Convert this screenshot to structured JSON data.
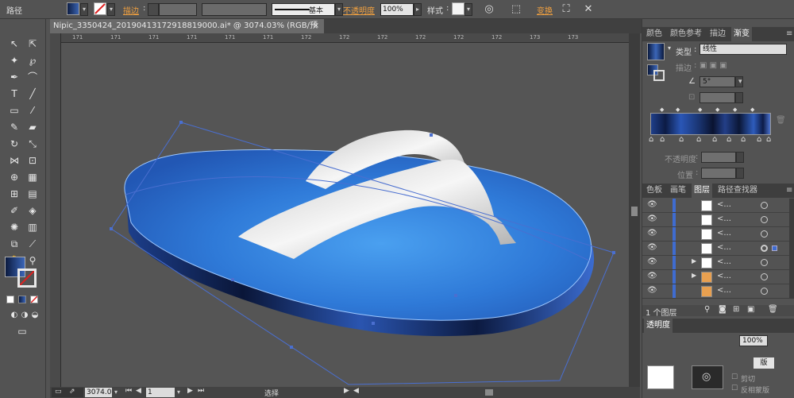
{
  "control_bar": {
    "object_type": "路径",
    "stroke_label": "描边",
    "stroke_profile": "基本",
    "opacity_label": "不透明度",
    "opacity_value": "100%",
    "style_label": "样式",
    "transform_label": "变换"
  },
  "document": {
    "tab_title": "Nipic_3350424_20190413172918819000.ai* @ 3074.03% (RGB/预览)",
    "close_glyph": "×",
    "ruler_ticks": [
      "171",
      "171",
      "171",
      "171",
      "171",
      "171",
      "172",
      "172",
      "172",
      "172",
      "172",
      "172",
      "173",
      "173"
    ]
  },
  "status_bar": {
    "zoom": "3074.0",
    "page": "1",
    "tool": "选择"
  },
  "gradient_panel": {
    "tabs": [
      "颜色",
      "颜色参考",
      "描边",
      "渐变"
    ],
    "active_tab": "渐变",
    "type_label": "类型",
    "type_value": "线性",
    "stroke_label": "描边",
    "angle_value": "5°",
    "opacity_label": "不透明度",
    "location_label": "位置"
  },
  "layers_panel": {
    "tabs": [
      "色板",
      "画笔",
      "图层",
      "路径查找器"
    ],
    "active_tab": "图层",
    "rows": [
      {
        "name": "<...",
        "expand": ""
      },
      {
        "name": "<...",
        "expand": ""
      },
      {
        "name": "<...",
        "expand": ""
      },
      {
        "name": "<...",
        "expand": ""
      },
      {
        "name": "<...",
        "expand": "▶"
      },
      {
        "name": "<...",
        "expand": "▶"
      },
      {
        "name": "<...",
        "expand": ""
      }
    ],
    "footer_count": "1 个图层"
  },
  "transparency_panel": {
    "title": "透明度",
    "opacity_value": "100%",
    "mask_button": "版",
    "clip_label": "剪切",
    "invert_label": "反相蒙版"
  },
  "colors": {
    "chrome_bg": "#535353",
    "canvas_bg": "#555555",
    "accent_orange": "#f0a040",
    "selection_blue": "#4a6fd0"
  }
}
